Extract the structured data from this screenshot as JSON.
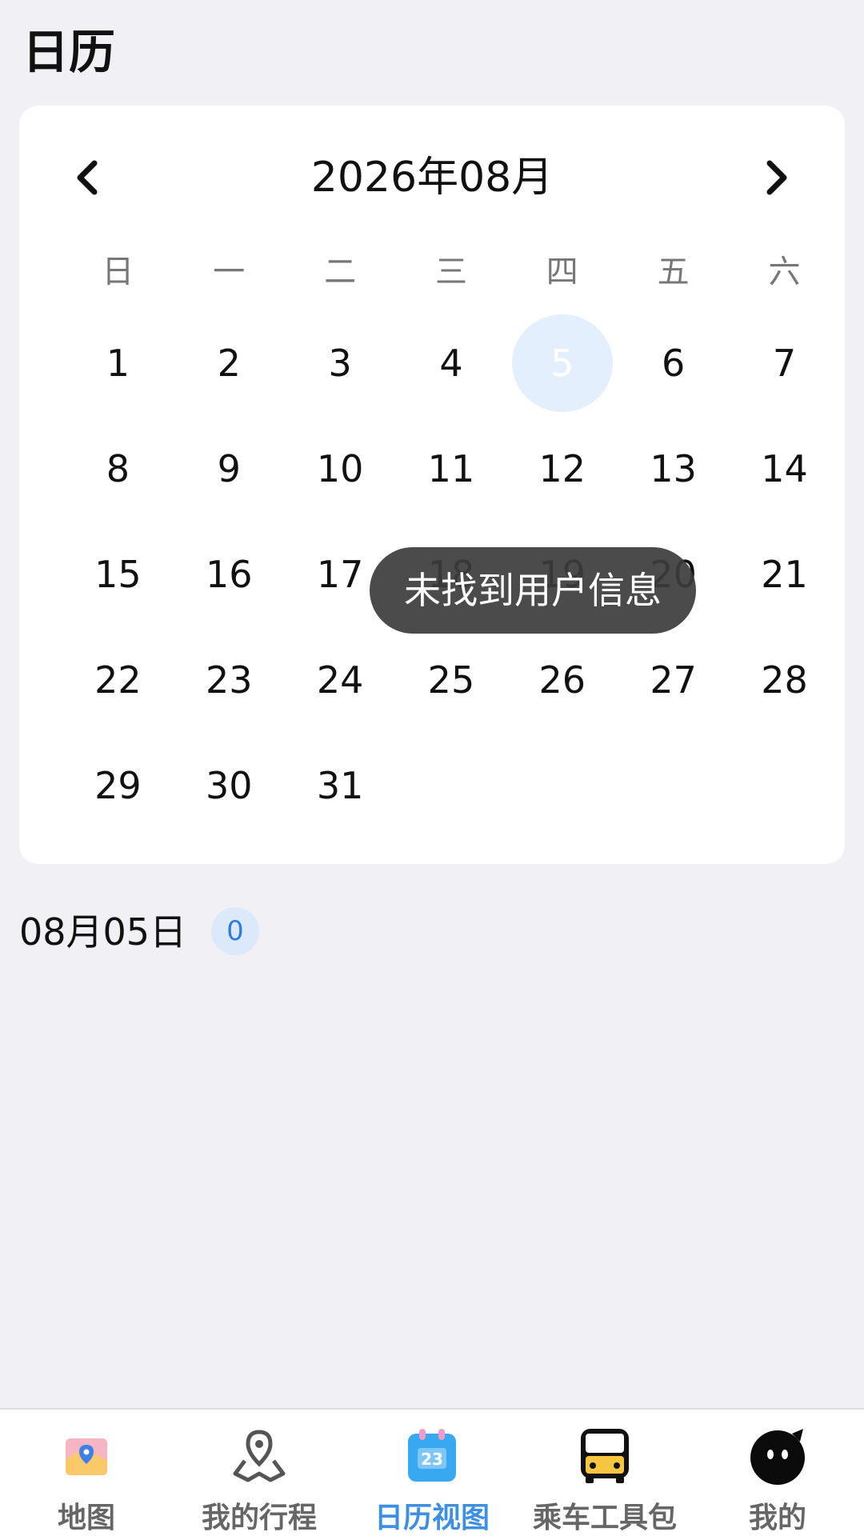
{
  "header": {
    "title": "日历"
  },
  "calendar": {
    "month_label": "2026年08月",
    "weekdays": [
      "日",
      "一",
      "二",
      "三",
      "四",
      "五",
      "六"
    ],
    "days": [
      "1",
      "2",
      "3",
      "4",
      "5",
      "6",
      "7",
      "8",
      "9",
      "10",
      "11",
      "12",
      "13",
      "14",
      "15",
      "16",
      "17",
      "18",
      "19",
      "20",
      "21",
      "22",
      "23",
      "24",
      "25",
      "26",
      "27",
      "28",
      "29",
      "30",
      "31"
    ],
    "selected_day": "5",
    "leading_blank_days": 0
  },
  "toast": {
    "message": "未找到用户信息"
  },
  "selection": {
    "date_label": "08月05日",
    "event_count": "0"
  },
  "tabbar": {
    "items": [
      {
        "label": "地图",
        "icon": "map-icon"
      },
      {
        "label": "我的行程",
        "icon": "route-pin-icon"
      },
      {
        "label": "日历视图",
        "icon": "calendar-icon"
      },
      {
        "label": "乘车工具包",
        "icon": "bus-icon"
      },
      {
        "label": "我的",
        "icon": "avatar-icon"
      }
    ],
    "active_index": 2
  },
  "colors": {
    "accent": "#3e8fe0",
    "selected_bg": "#e3effd",
    "badge_bg": "#dbe9fb"
  }
}
